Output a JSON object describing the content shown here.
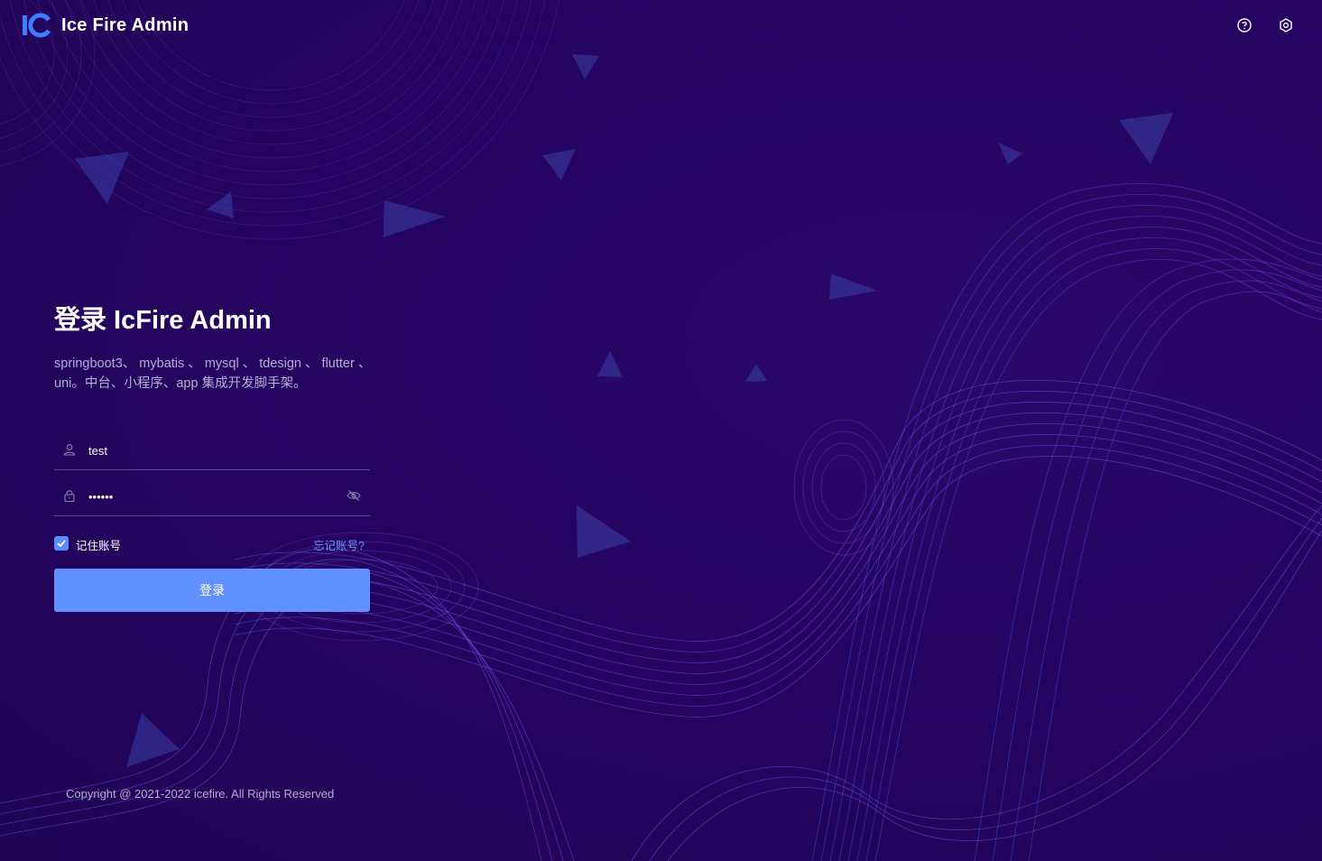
{
  "header": {
    "brand": "Ice Fire Admin",
    "logo_text": "IC",
    "help_icon": "help-circle-icon",
    "settings_icon": "settings-gear-icon"
  },
  "login": {
    "title": "登录 IcFire Admin",
    "subtitle": "springboot3、 mybatis 、 mysql 、 tdesign 、 flutter 、 uni。中台、小程序、app 集成开发脚手架。",
    "username": {
      "value": "test",
      "icon": "user-icon"
    },
    "password": {
      "value": "123456",
      "icon": "lock-icon",
      "toggle_icon": "eye-off-icon"
    },
    "remember": {
      "label": "记住账号",
      "checked": true
    },
    "forgot_label": "忘记账号?",
    "submit_label": "登录"
  },
  "footer": {
    "copyright": "Copyright @ 2021-2022 icefire. All Rights Reserved"
  },
  "colors": {
    "background": "#24045f",
    "accent": "#6190ff",
    "link": "#6e95ff",
    "logo": "#3d7eff"
  }
}
